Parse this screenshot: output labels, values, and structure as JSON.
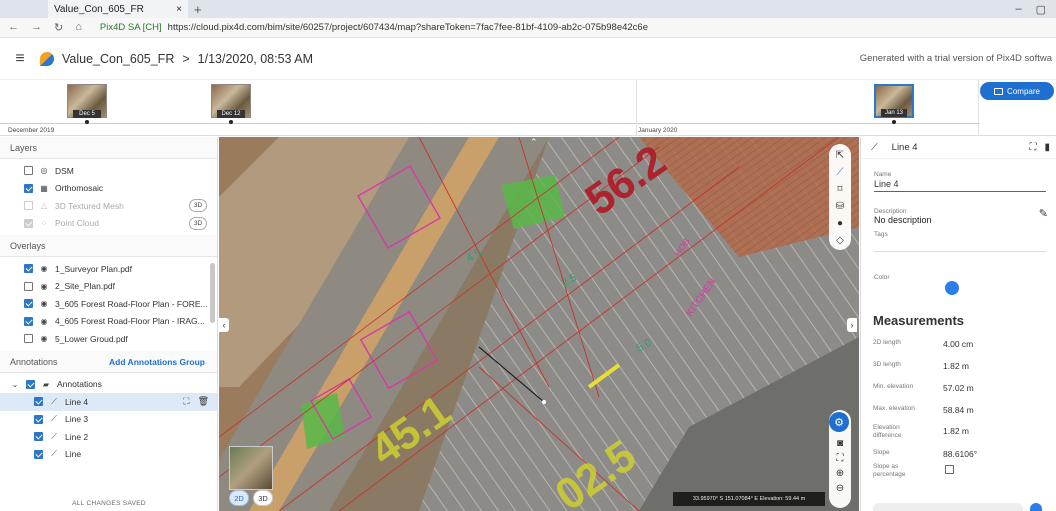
{
  "browser": {
    "tab_title": "Value_Con_605_FR",
    "tab_close": "×",
    "new_tab": "+",
    "site_label": "Pix4D SA [CH]",
    "url": "https://cloud.pix4d.com/bim/site/60257/project/607434/map?shareToken=7fac7fee-81bf-4109-ab2c-075b98e42c6e"
  },
  "header": {
    "project_name": "Value_Con_605_FR",
    "separator": ">",
    "date": "1/13/2020, 08:53 AM",
    "trial_note": "Generated with a trial version of Pix4D softwa"
  },
  "timeline": {
    "month_1": "December 2019",
    "month_2": "January 2020",
    "thumbs": [
      "Dec 5",
      "Dec 12",
      "Jan 13"
    ],
    "compare_label": "Compare"
  },
  "layers": {
    "title": "Layers",
    "items": [
      {
        "label": "DSM",
        "checked": false,
        "dim": false,
        "badge": ""
      },
      {
        "label": "Orthomosaic",
        "checked": true,
        "dim": false,
        "badge": ""
      },
      {
        "label": "3D Textured Mesh",
        "checked": false,
        "dim": true,
        "badge": "3D"
      },
      {
        "label": "Point Cloud",
        "checked": true,
        "dim": true,
        "badge": "3D"
      }
    ]
  },
  "overlays": {
    "title": "Overlays",
    "items": [
      {
        "label": "1_Surveyor Plan.pdf",
        "checked": true
      },
      {
        "label": "2_Site_Plan.pdf",
        "checked": false
      },
      {
        "label": "3_605 Forest Road-Floor Plan - FORE...",
        "checked": true
      },
      {
        "label": "4_605 Forest Road-Floor Plan - IRAG...",
        "checked": true
      },
      {
        "label": "5_Lower Groud.pdf",
        "checked": false
      }
    ]
  },
  "annotations": {
    "title": "Annotations",
    "add_label": "Add Annotations Group",
    "group_label": "Annotations",
    "items": [
      {
        "label": "Line 4",
        "selected": true
      },
      {
        "label": "Line 3",
        "selected": false
      },
      {
        "label": "Line 2",
        "selected": false
      },
      {
        "label": "Line",
        "selected": false
      }
    ]
  },
  "status": {
    "saved": "ALL CHANGES SAVED"
  },
  "map": {
    "mode_2d": "2D",
    "mode_3d": "3D",
    "coords": "33.95970° S 151.07084° E  Elevation: 59.44 m",
    "overlay_text": [
      "56.2",
      "45.1",
      "02.5",
      "KITCHEN",
      "HOB"
    ]
  },
  "panel": {
    "title": "Line 4",
    "name_label": "Name",
    "name_value": "Line 4",
    "description_label": "Description",
    "description_value": "No description",
    "tags_label": "Tags",
    "color_label": "Color",
    "color_value": "#2b7de9",
    "measurements_title": "Measurements",
    "measurements": [
      {
        "label": "2D length",
        "value": "4.00 cm"
      },
      {
        "label": "3D length",
        "value": "1.82 m"
      },
      {
        "label": "Min. elevation",
        "value": "57.02 m"
      },
      {
        "label": "Max. elevation",
        "value": "58.84 m"
      },
      {
        "label": "Elevation difference",
        "value": "1.82 m"
      },
      {
        "label": "Slope",
        "value": "88.6106°"
      },
      {
        "label": "Slope as percentage",
        "value": ""
      }
    ]
  },
  "colors": {
    "accent": "#1f6fd0",
    "selected_row": "#dde9f6"
  }
}
